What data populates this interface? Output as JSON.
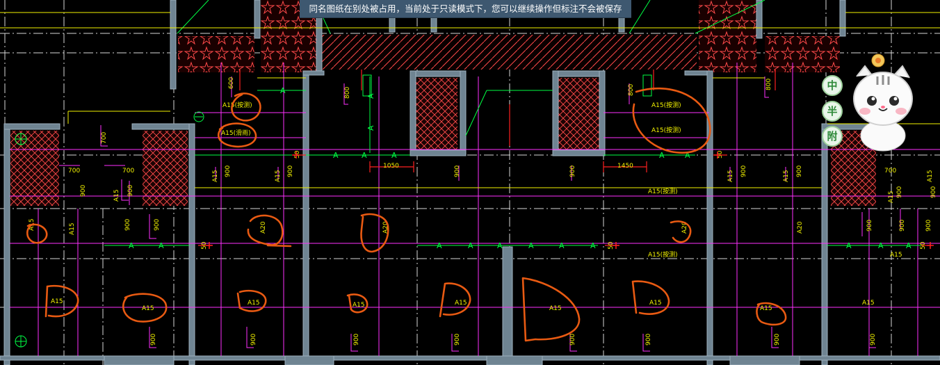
{
  "banner": {
    "message": "同名图纸在别处被占用，当前处于只读模式下，您可以继续操作但标注不会被保存"
  },
  "drawing": {
    "dims": {
      "d600": "600",
      "d700": "700",
      "d800": "800",
      "d900": "900",
      "d1050": "1050",
      "d1450": "1450",
      "d50": "50"
    },
    "labels": {
      "A": "A",
      "A15": "A15",
      "A20": "A20",
      "A15_note": "A15(按测)",
      "A15_note2": "A15(滑雨)"
    },
    "colors": {
      "wall": "#8a9aa8",
      "wall_fill": "#6f8492",
      "hatch": "#ff4a4a",
      "grid": "#ffffff",
      "green": "#00ff44",
      "magenta": "#ff30ff",
      "yellow": "#f2f200",
      "red": "#ff2020",
      "markup": "#e85a12",
      "cyan": "#3cd0d0"
    }
  },
  "mascot": {
    "badges": [
      "中",
      "半",
      "附"
    ],
    "icon": "cat-mascot-icon"
  }
}
